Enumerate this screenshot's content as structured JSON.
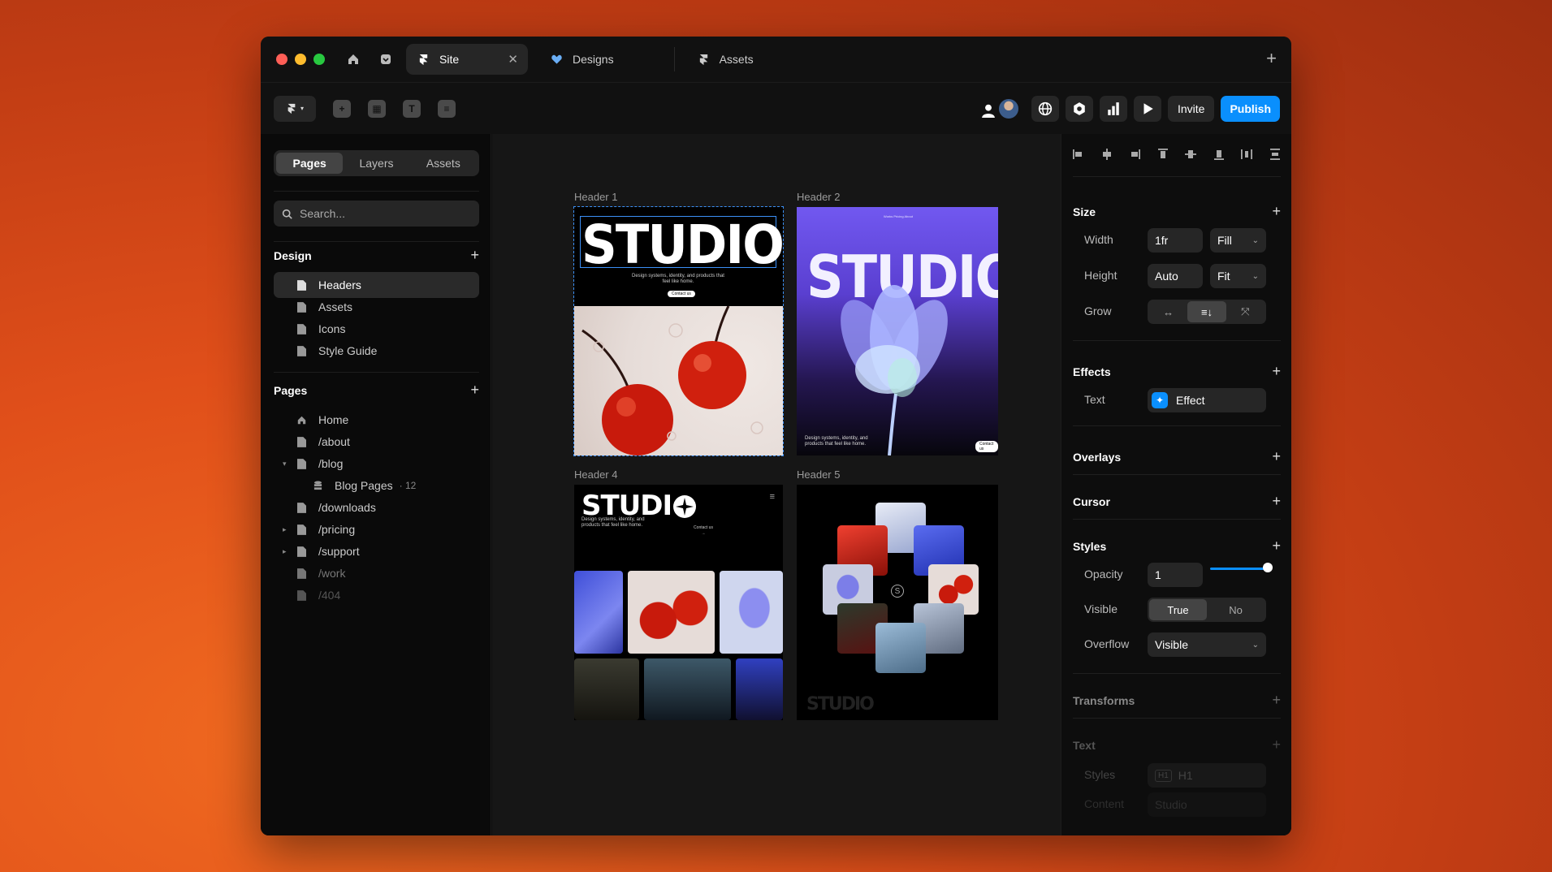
{
  "tabs": [
    {
      "label": "Site",
      "active": true
    },
    {
      "label": "Designs"
    },
    {
      "label": "Assets"
    }
  ],
  "toolbar": {
    "invite_label": "Invite",
    "publish_label": "Publish",
    "accent": "#0a8ffd",
    "tools": [
      "insert-icon",
      "layout-icon",
      "text-icon",
      "cms-icon"
    ]
  },
  "left": {
    "segments": [
      "Pages",
      "Layers",
      "Assets"
    ],
    "active_segment": "Pages",
    "search_placeholder": "Search...",
    "design_title": "Design",
    "design_items": [
      "Headers",
      "Assets",
      "Icons",
      "Style Guide"
    ],
    "pages_title": "Pages",
    "pages": [
      {
        "label": "Home",
        "icon": "home-icon"
      },
      {
        "label": "/about"
      },
      {
        "label": "/blog",
        "expanded": true
      },
      {
        "label": "Blog Pages",
        "count": "12",
        "icon": "cms-icon"
      },
      {
        "label": "/downloads"
      },
      {
        "label": "/pricing",
        "collapsed": true
      },
      {
        "label": "/support",
        "collapsed": true
      },
      {
        "label": "/work"
      },
      {
        "label": "/404"
      }
    ]
  },
  "canvas": {
    "frames": [
      {
        "label": "Header 1",
        "title": "STUDIO",
        "tagline": "Design systems, identity, and products that feel like home.",
        "cta": "Contact us"
      },
      {
        "label": "Header 2",
        "title": "STUDIO",
        "nav": "Works   Pricing   About",
        "tagline": "Design systems, identity, and products that feel like home.",
        "cta": "Contact us"
      },
      {
        "label": "Header 4",
        "title": "STUDI",
        "tagline": "Design systems, identity, and products that feel like home.",
        "cta": "Contact us →"
      },
      {
        "label": "Header 5",
        "title": "STUDIO"
      }
    ]
  },
  "right": {
    "size_title": "Size",
    "width_label": "Width",
    "width_value": "1fr",
    "width_mode": "Fill",
    "height_label": "Height",
    "height_value": "Auto",
    "height_mode": "Fit",
    "grow_label": "Grow",
    "effects_title": "Effects",
    "effects_text_label": "Text",
    "effect_value": "Effect",
    "overlays_title": "Overlays",
    "cursor_title": "Cursor",
    "styles_title": "Styles",
    "opacity_label": "Opacity",
    "opacity_value": "1",
    "visible_label": "Visible",
    "visible_true": "True",
    "visible_false": "No",
    "overflow_label": "Overflow",
    "overflow_value": "Visible",
    "transforms_title": "Transforms",
    "text_title": "Text",
    "text_styles_label": "Styles",
    "text_styles_tag": "H1",
    "text_styles_value": "H1",
    "content_label": "Content",
    "content_value": "Studio"
  }
}
